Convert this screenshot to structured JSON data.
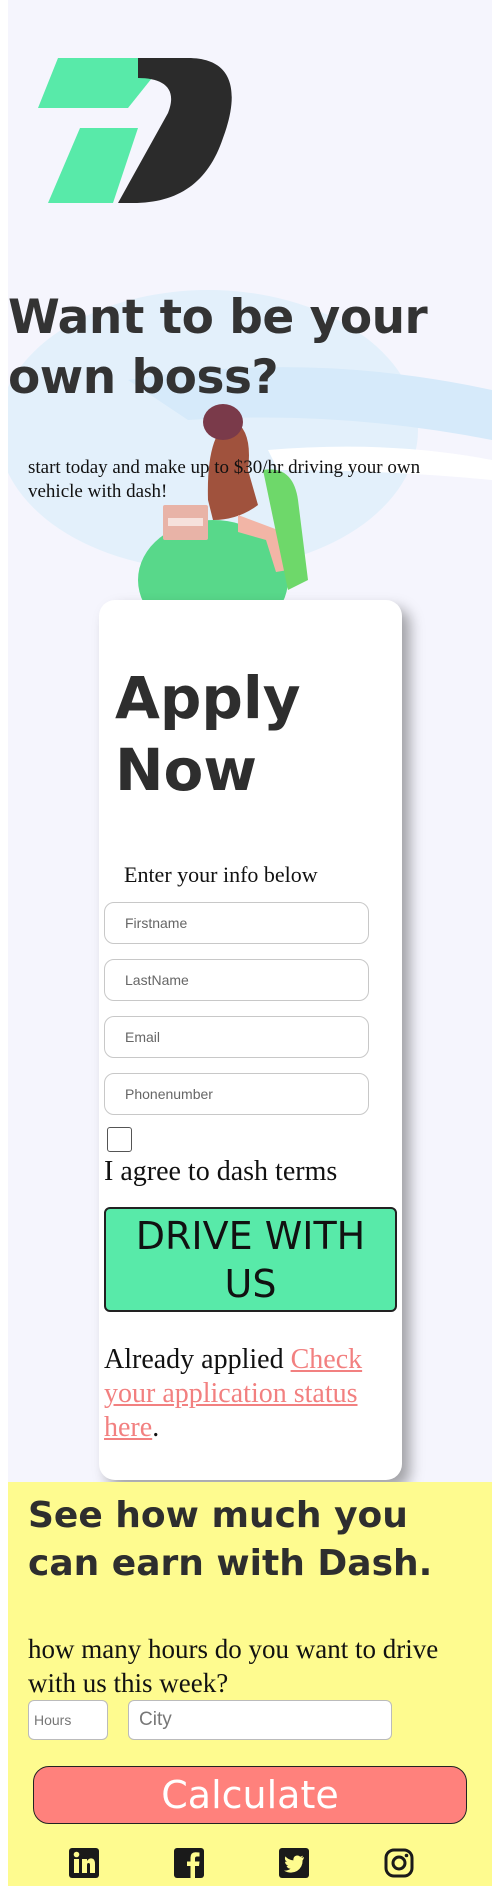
{
  "hero": {
    "title": "Want to be your own boss?",
    "subtitle": "start today and make up to $30/hr driving your own vehicle with dash!"
  },
  "apply": {
    "title": "Apply Now",
    "subtitle": "Enter your info below",
    "fields": {
      "firstname": "Firstname",
      "lastname": "LastName",
      "email": "Email",
      "phone": "Phonenumber"
    },
    "agree_label": "I agree to dash terms",
    "submit_label": "DRIVE WITH US",
    "already_text": "Already applied ",
    "status_link": "Check your application status here",
    "period": "."
  },
  "calculator": {
    "title": "See how much you can earn with Dash.",
    "question": "how many hours do you want to drive with us this week?",
    "hours_placeholder": "Hours",
    "city_placeholder": "City",
    "button_label": "Calculate"
  },
  "socials": [
    "linkedin-icon",
    "facebook-icon",
    "twitter-icon",
    "instagram-icon"
  ],
  "colors": {
    "brand_green": "#58eaa9",
    "accent_coral": "#ff817c",
    "calc_bg": "#fefb8f",
    "page_bg": "#f5f5fd"
  }
}
